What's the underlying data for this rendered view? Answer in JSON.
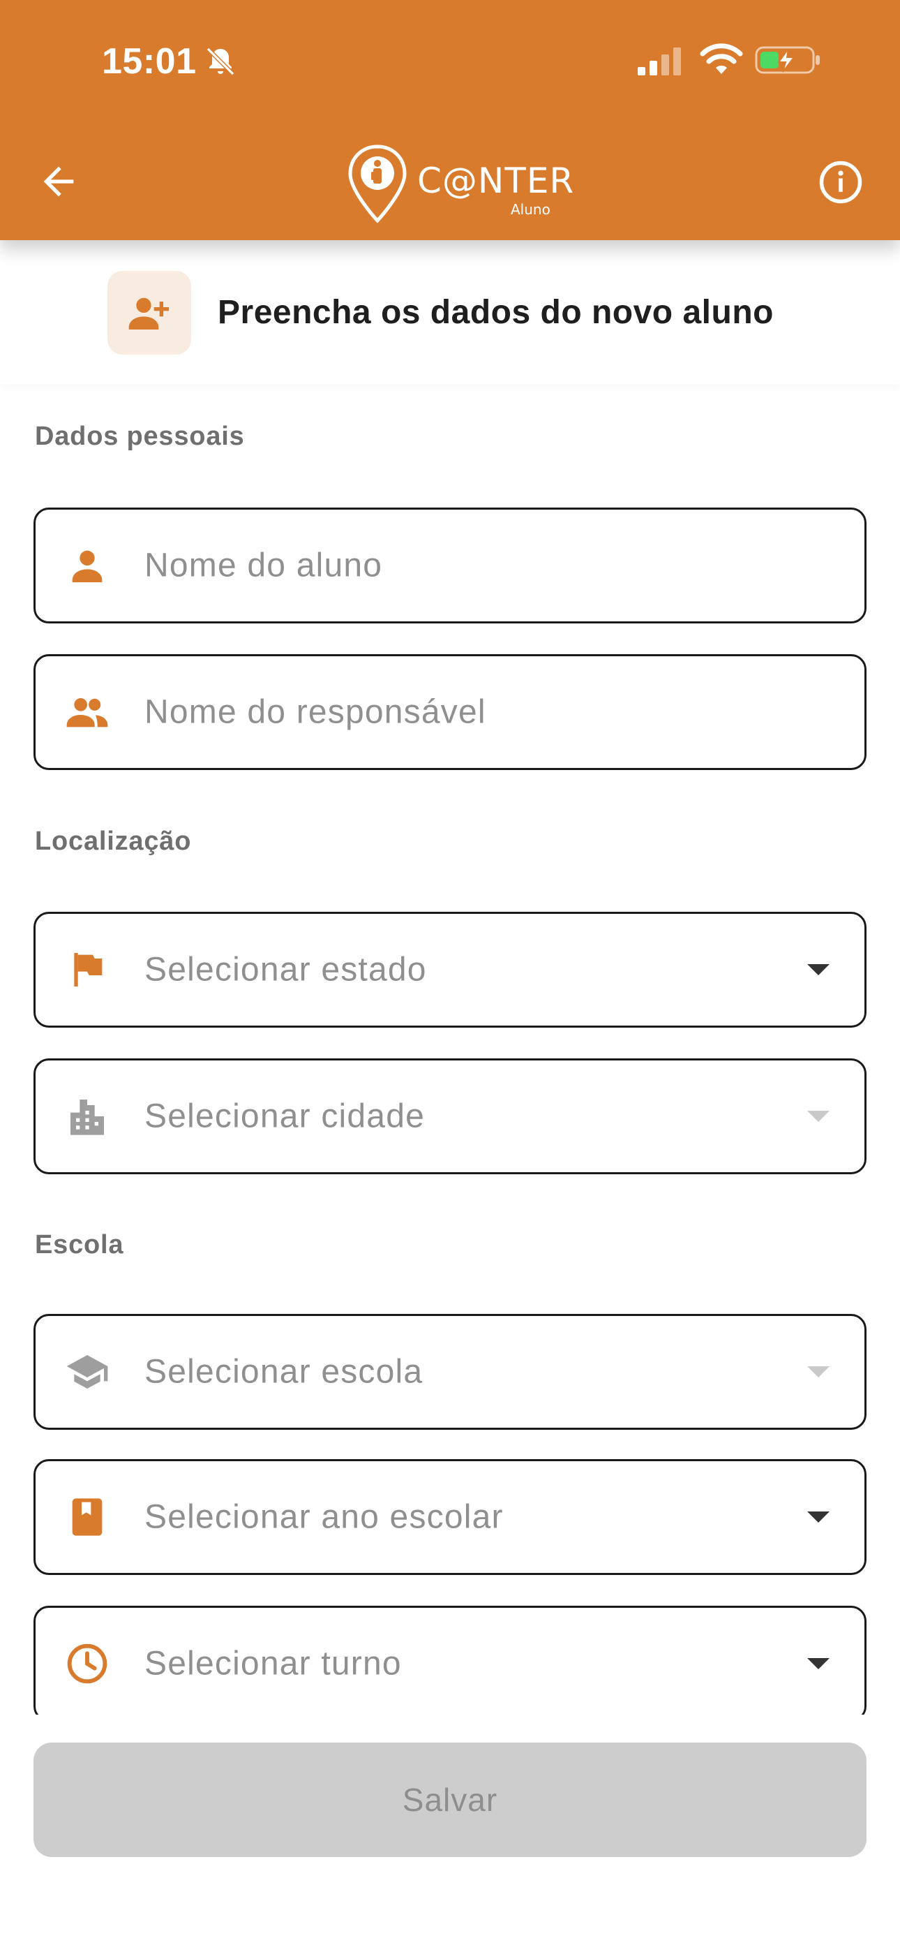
{
  "status_bar": {
    "time": "15:01"
  },
  "header": {
    "logo_text": "C@NTER",
    "logo_subtext": "Aluno",
    "icons": {
      "back": "arrow-left-icon",
      "info": "info-circle-icon"
    }
  },
  "title": {
    "text": "Preencha os dados do novo aluno",
    "icon": "person-add-icon"
  },
  "sections": {
    "personal": "Dados pessoais",
    "location": "Localização",
    "school": "Escola"
  },
  "fields": {
    "student_name": {
      "placeholder": "Nome do aluno",
      "icon": "person-icon"
    },
    "guardian_name": {
      "placeholder": "Nome do responsável",
      "icon": "people-icon"
    },
    "state": {
      "placeholder": "Selecionar estado",
      "icon": "flag-icon"
    },
    "city": {
      "placeholder": "Selecionar cidade",
      "icon": "city-icon"
    },
    "school": {
      "placeholder": "Selecionar escola",
      "icon": "graduation-cap-icon"
    },
    "grade": {
      "placeholder": "Selecionar ano escolar",
      "icon": "book-icon"
    },
    "shift": {
      "placeholder": "Selecionar turno",
      "icon": "clock-icon"
    }
  },
  "save_button": {
    "label": "Salvar"
  },
  "colors": {
    "brand": "#D97B2C",
    "icon_active": "#D97B2C",
    "icon_muted": "#9E9E9E",
    "title_icon_bg": "#F8EBDF",
    "button_disabled": "#CDCDCD"
  }
}
